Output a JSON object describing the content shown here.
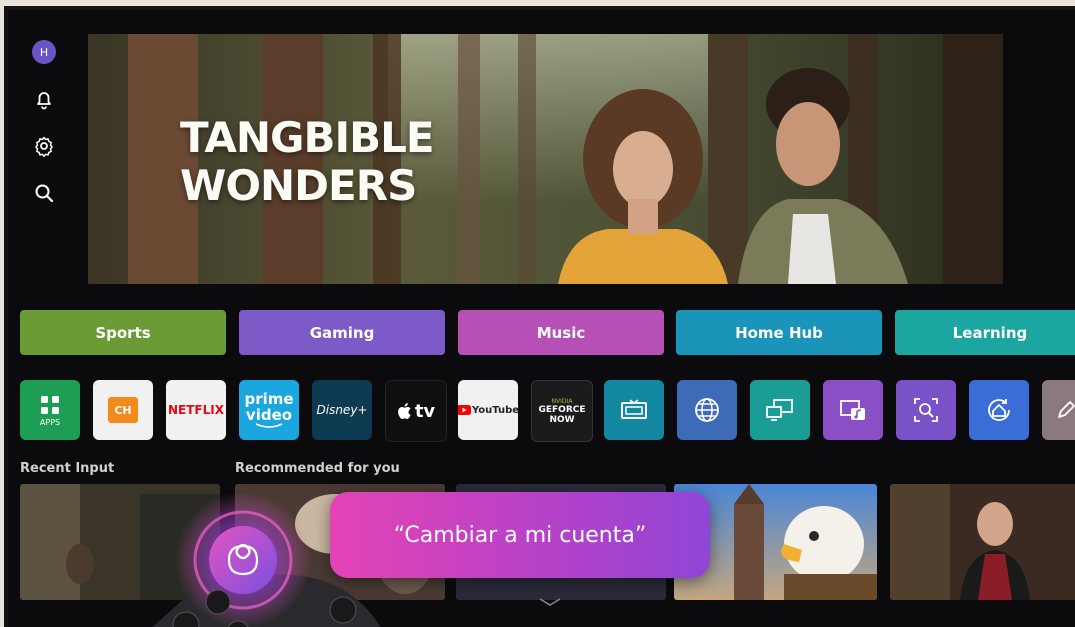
{
  "profile": {
    "initial": "H"
  },
  "rail": {
    "icons": [
      "profile-avatar",
      "bell-icon",
      "gear-icon",
      "search-icon"
    ]
  },
  "hero": {
    "title_line1": "TANGBIBLE",
    "title_line2": "WONDERS"
  },
  "categories": [
    {
      "label": "Sports",
      "color": "#6a9b34"
    },
    {
      "label": "Gaming",
      "color": "#7c5bc9"
    },
    {
      "label": "Music",
      "color": "#b64fb6"
    },
    {
      "label": "Home Hub",
      "color": "#1a94b8"
    },
    {
      "label": "Learning",
      "color": "#1ba6a2"
    }
  ],
  "apps": {
    "apps_label": "APPS",
    "ch_label": "CH",
    "netflix": "NETFLIX",
    "prime_line1": "prime",
    "prime_line2": "video",
    "disney": "Disney+",
    "appletv": "tv",
    "youtube": "YouTube",
    "geforce_line1": "NVIDIA",
    "geforce_line2": "GEFORCE",
    "geforce_line3": "NOW"
  },
  "sections": {
    "recent_input": "Recent Input",
    "recommended": "Recommended for you"
  },
  "voice": {
    "utterance": "“Cambiar a mi cuenta”"
  },
  "colors": {
    "background": "#0b0b0e",
    "bubble_start": "#e443b5",
    "bubble_end": "#8f46d6"
  }
}
